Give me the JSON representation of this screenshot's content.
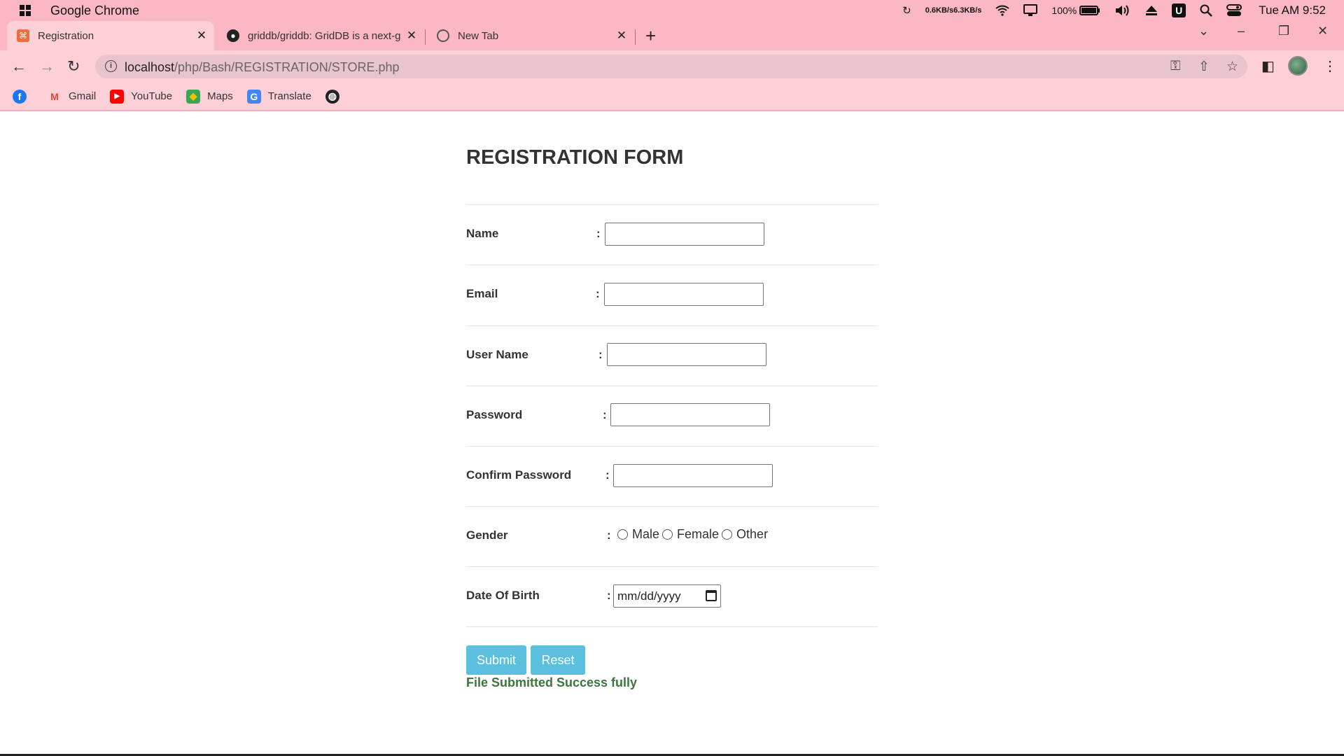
{
  "os": {
    "app_title": "Google Chrome",
    "net_up": "0.6KB/s",
    "net_down": "6.3KB/s",
    "battery": "100%",
    "clock": "Tue AM 9:52",
    "icons": [
      "sync-icon",
      "wifi-icon",
      "display-icon",
      "battery-icon",
      "volume-icon",
      "eject-icon",
      "u-app-icon",
      "search-icon",
      "toggle-icon"
    ]
  },
  "tabs": [
    {
      "label": "Registration",
      "icon": "xampp-icon",
      "active": true
    },
    {
      "label": "griddb/griddb: GridDB is a next-g",
      "icon": "github-icon",
      "active": false
    },
    {
      "label": "New Tab",
      "icon": "chrome-icon",
      "active": false
    }
  ],
  "address": {
    "host": "localhost",
    "path": "/php/Bash/REGISTRATION/STORE.php"
  },
  "bookmarks": [
    {
      "label": "",
      "icon": "facebook-icon"
    },
    {
      "label": "Gmail",
      "icon": "gmail-icon"
    },
    {
      "label": "YouTube",
      "icon": "youtube-icon"
    },
    {
      "label": "Maps",
      "icon": "maps-icon"
    },
    {
      "label": "Translate",
      "icon": "translate-icon"
    },
    {
      "label": "",
      "icon": "globe-icon"
    }
  ],
  "form": {
    "title": "REGISTRATION FORM",
    "colon": ":",
    "fields": {
      "name": {
        "label": "Name",
        "value": ""
      },
      "email": {
        "label": "Email",
        "value": ""
      },
      "username": {
        "label": "User Name",
        "value": ""
      },
      "password": {
        "label": "Password",
        "value": ""
      },
      "confirm": {
        "label": "Confirm Password",
        "value": ""
      },
      "gender": {
        "label": "Gender",
        "options": [
          "Male",
          "Female",
          "Other"
        ]
      },
      "dob": {
        "label": "Date Of Birth",
        "placeholder": "mm/dd/yyyy"
      }
    },
    "submit_label": "Submit",
    "reset_label": "Reset",
    "status_message": "File Submitted Success fully",
    "status_color": "#3c763d",
    "button_color": "#5bc0de"
  },
  "colors": {
    "chrome_bg": "#fbb7c3",
    "toolbar_bg": "#fdd0d8"
  }
}
